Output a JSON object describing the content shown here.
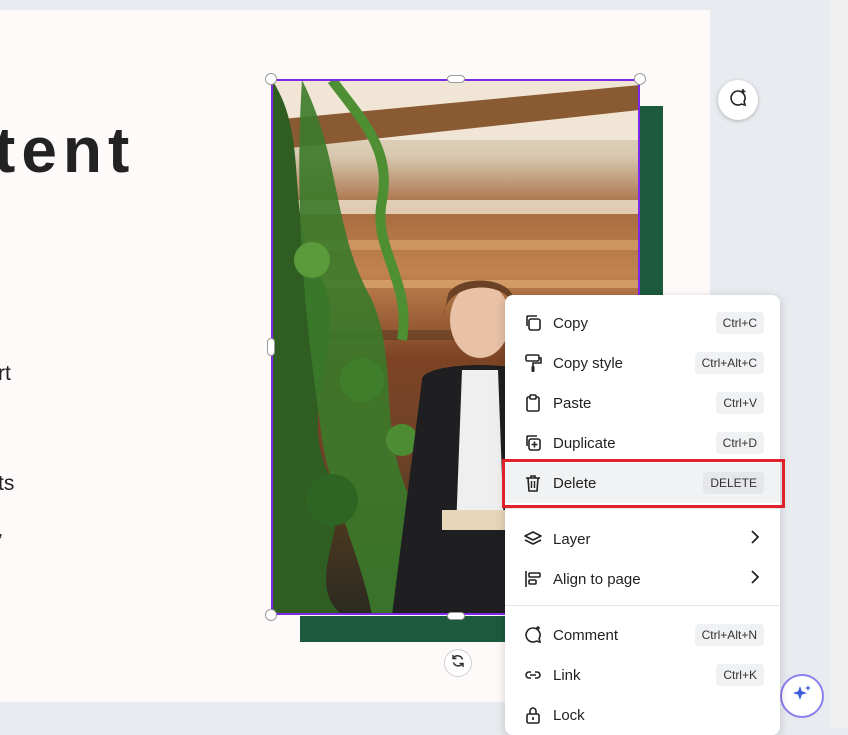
{
  "canvas": {
    "heading_fragment": "tent",
    "text_fragments": [
      "rt",
      "ts",
      ","
    ]
  },
  "colors": {
    "selection": "#7d2ae8",
    "frame_green": "#1d5a3d",
    "highlight_red": "#e0202b"
  },
  "context_menu": {
    "items": [
      {
        "label": "Copy",
        "shortcut": "Ctrl+C",
        "icon": "copy-icon"
      },
      {
        "label": "Copy style",
        "shortcut": "Ctrl+Alt+C",
        "icon": "paint-roller-icon"
      },
      {
        "label": "Paste",
        "shortcut": "Ctrl+V",
        "icon": "clipboard-icon"
      },
      {
        "label": "Duplicate",
        "shortcut": "Ctrl+D",
        "icon": "duplicate-icon"
      },
      {
        "label": "Delete",
        "shortcut": "DELETE",
        "icon": "trash-icon",
        "highlighted": true
      },
      {
        "label": "Layer",
        "icon": "layers-icon",
        "submenu": true
      },
      {
        "label": "Align to page",
        "icon": "align-icon",
        "submenu": true
      },
      {
        "label": "Comment",
        "shortcut": "Ctrl+Alt+N",
        "icon": "comment-icon"
      },
      {
        "label": "Link",
        "shortcut": "Ctrl+K",
        "icon": "link-icon"
      },
      {
        "label": "Lock",
        "icon": "lock-icon"
      }
    ]
  }
}
